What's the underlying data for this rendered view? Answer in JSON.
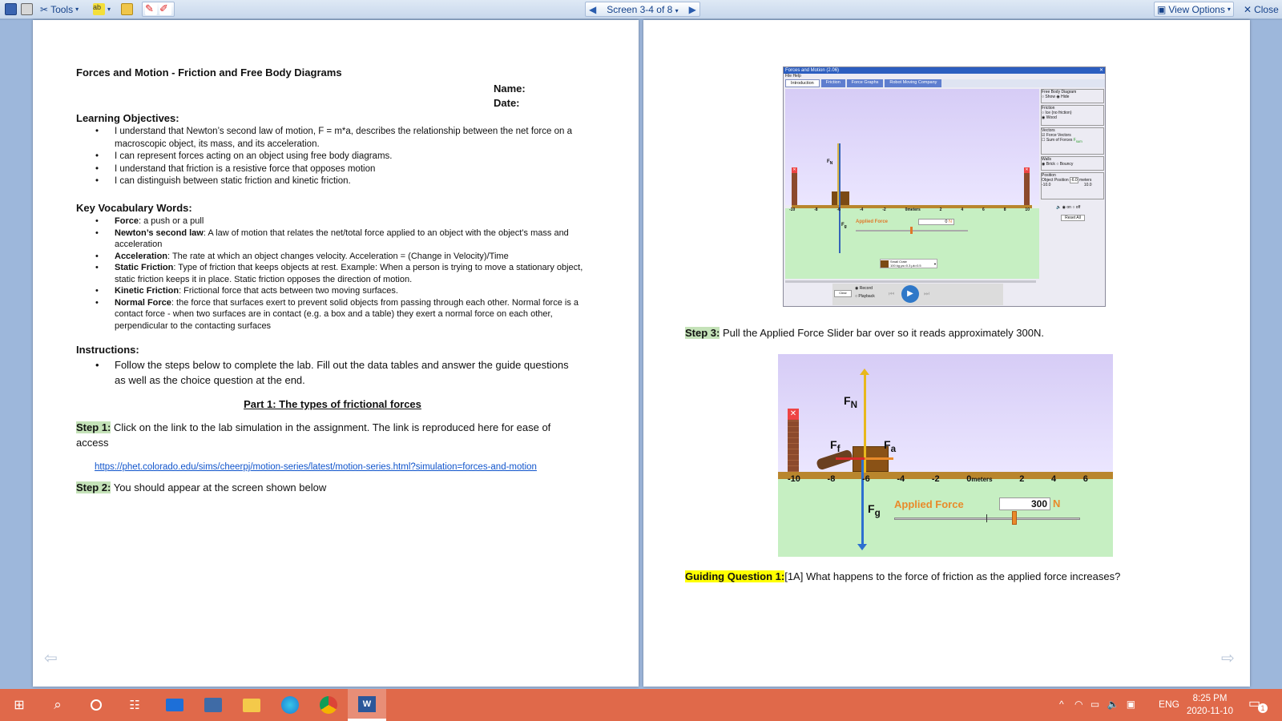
{
  "toolbar": {
    "tools": "Tools",
    "screen": "Screen 3-4 of 8",
    "view_options": "View Options",
    "close": "Close"
  },
  "left": {
    "title": "Forces and Motion - Friction and Free Body Diagrams",
    "name_label": "Name:",
    "date_label": "Date:",
    "objectives_heading": "Learning Objectives:",
    "objectives": [
      "I understand that Newton’s second law of motion, F = m*a, describes the relationship between the net force on a macroscopic object, its mass, and its acceleration.",
      "I can represent forces acting on an object using free body diagrams.",
      "I understand that friction is a resistive force that opposes motion",
      "I can distinguish between static friction and kinetic friction."
    ],
    "vocab_heading": "Key Vocabulary Words:",
    "vocab": [
      {
        "term": "Force",
        "def": ": a push or a pull"
      },
      {
        "term": "Newton’s second law",
        "def": ": A law of motion that relates the net/total force applied to an object with the object’s mass and acceleration"
      },
      {
        "term": "Acceleration",
        "def": ": The rate at which an object changes velocity. Acceleration = (Change in Velocity)/Time"
      },
      {
        "term": "Static Friction",
        "def": ": Type of friction that keeps objects at rest. Example: When a person is trying to move a stationary object, static friction keeps it in place. Static friction opposes the direction of motion."
      },
      {
        "term": "Kinetic Friction",
        "def": ": Frictional force that acts between two moving surfaces."
      },
      {
        "term": "Normal Force",
        "def": ":  the force that surfaces exert to prevent solid objects from passing through each other. Normal force is a contact force - when two surfaces are in contact (e.g. a box and a table) they exert a normal force on each other, perpendicular to the contacting surfaces"
      }
    ],
    "instructions_heading": "Instructions:",
    "instruction": "Follow the steps below to complete the lab. Fill out the data tables and answer the guide questions as well as the choice question at the end.",
    "part1": "Part 1: The types of frictional forces",
    "step1_label": "Step 1:",
    "step1_text": " Click on the link to the lab simulation in the assignment. The link is reproduced here for ease of access",
    "link": "https://phet.colorado.edu/sims/cheerpj/motion-series/latest/motion-series.html?simulation=forces-and-motion",
    "step2_label": "Step 2:",
    "step2_text": " You should appear at the screen shown below"
  },
  "right": {
    "sim": {
      "title": "Forces and Motion (2.06)",
      "menu": "File  Help",
      "tabs": [
        "Introduction",
        "Friction",
        "Force Graphs",
        "Robot Moving Company"
      ],
      "panel": {
        "fbd": "Free Body Diagram",
        "fbd_show": "Show",
        "fbd_hide": "Hide",
        "friction": "Friction",
        "ice": "Ice (no friction)",
        "wood": "Wood",
        "vectors": "Vectors",
        "force_vectors": "Force Vectors",
        "sum_forces": "Sum of Forces",
        "fsum": "F",
        "fsum_sub": "sum",
        "walls": "Walls",
        "brick": "Brick",
        "bouncy": "Bouncy",
        "position": "Position",
        "object_position": "Object Position",
        "pos_value": "-6.0",
        "meters": "meters",
        "range_min": "-10.0",
        "range_max": "10.0",
        "sound_on": "on",
        "sound_off": "off",
        "reset": "Reset All"
      },
      "ticks": [
        "-10",
        "-8",
        "-6",
        "-4",
        "-2",
        "0",
        "2",
        "4",
        "6",
        "8",
        "10"
      ],
      "meters": "meters",
      "applied_force": "Applied Force",
      "af_value": "0",
      "unit": "N",
      "crate": "Small Crate",
      "crate_sub": "100 kg μs=0.3 μk=0.5",
      "clear": "Clear",
      "record": "Record",
      "playback": "Playback",
      "fn": "F",
      "fn_sub": "N",
      "fg": "F",
      "fg_sub": "g"
    },
    "step3_label": "Step 3:",
    "step3_text": " Pull the Applied Force Slider bar over so it reads approximately 300N.",
    "zoom": {
      "ticks": [
        "-10",
        "-8",
        "-6",
        "-4",
        "-2",
        "0",
        "2",
        "4",
        "6"
      ],
      "meters": "meters",
      "applied_force": "Applied Force",
      "value": "300",
      "unit": "N",
      "fn": "F",
      "fn_sub": "N",
      "fg": "F",
      "fg_sub": "g",
      "ff": "F",
      "ff_sub": "f",
      "fa": "F",
      "fa_sub": "a"
    },
    "gq1_label": "Guiding Question 1:",
    "gq1_text": "[1A] What happens to the force of friction as the applied force increases?"
  },
  "taskbar": {
    "time": "8:25 PM",
    "date": "2020-11-10",
    "lang": "ENG",
    "notification_count": "1"
  }
}
